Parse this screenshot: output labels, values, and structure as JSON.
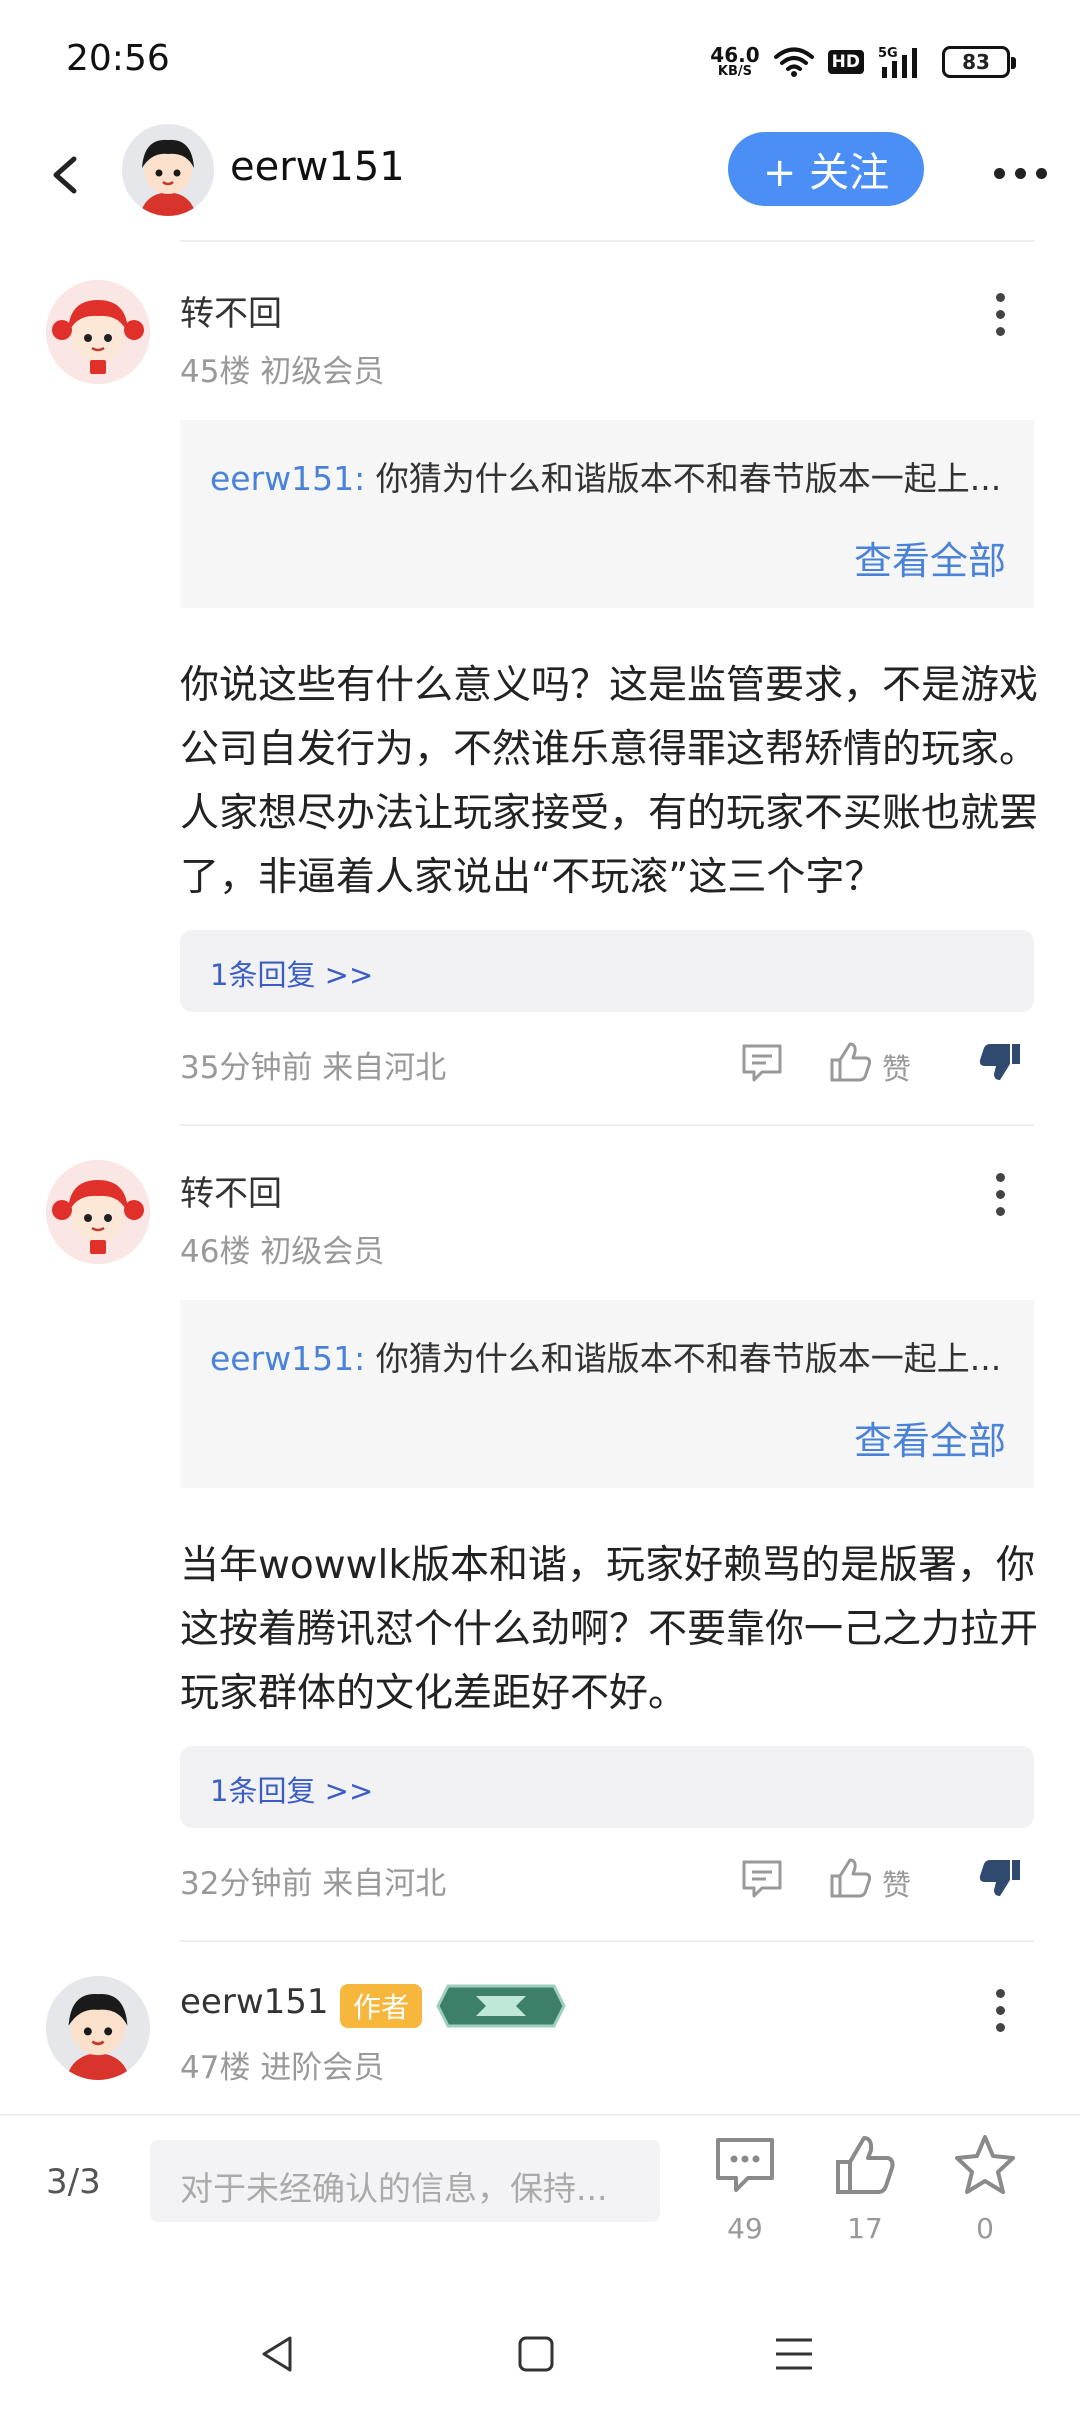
{
  "status_bar": {
    "time": "20:56",
    "net_speed": "46.0",
    "net_unit": "KB/S",
    "hd_label": "HD",
    "signal_label": "5G",
    "battery": "83",
    "icons": [
      "wifi-icon",
      "signal-icon",
      "battery-icon"
    ]
  },
  "header": {
    "username": "eerw151",
    "follow_label": "+ 关注",
    "icons": [
      "back-arrow-icon",
      "more-icon"
    ]
  },
  "comments": [
    {
      "name": "转不回",
      "meta": "45楼 初级会员",
      "quote_user": "eerw151:",
      "quote_text": "你猜为什么和谐版本不和春节版本一起上...",
      "quote_more": "查看全部",
      "body": "你说这些有什么意义吗？这是监管要求，不是游戏公司自发行为，不然谁乐意得罪这帮矫情的玩家。人家想尽办法让玩家接受，有的玩家不买账也就罢了，非逼着人家说出“不玩滚”这三个字？",
      "replies": "1条回复 >>",
      "time_loc": "35分钟前 来自河北",
      "like_label": "赞"
    },
    {
      "name": "转不回",
      "meta": "46楼 初级会员",
      "quote_user": "eerw151:",
      "quote_text": "你猜为什么和谐版本不和春节版本一起上...",
      "quote_more": "查看全部",
      "body": "当年wowwlk版本和谐，玩家好赖骂的是版署，你这按着腾讯怼个什么劲啊？不要靠你一己之力拉开玩家群体的文化差距好不好。",
      "replies": "1条回复 >>",
      "time_loc": "32分钟前 来自河北",
      "like_label": "赞"
    },
    {
      "name": "eerw151",
      "badge": "作者",
      "meta": "47楼 进阶会员"
    }
  ],
  "bottom_bar": {
    "page": "3/3",
    "input_placeholder": "对于未经确认的信息，保持...",
    "comments_count": "49",
    "likes_count": "17",
    "favorites_count": "0"
  },
  "colors": {
    "accent": "#4b8ef5",
    "link": "#4a82d8",
    "reply_link": "#3b5ec6",
    "author_badge": "#f6b73c"
  }
}
